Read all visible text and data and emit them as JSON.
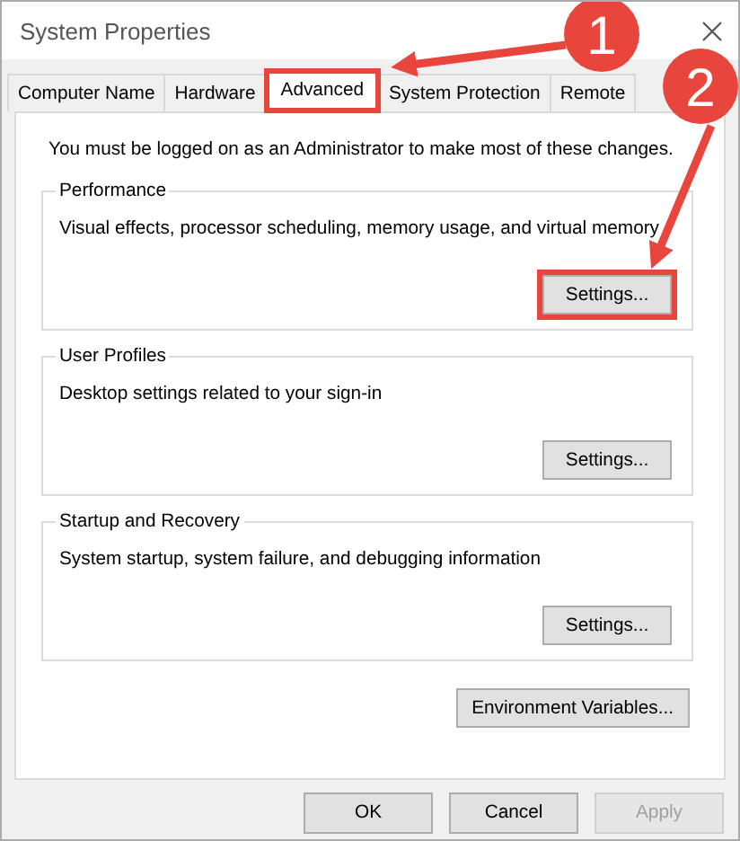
{
  "window": {
    "title": "System Properties"
  },
  "tabs": [
    {
      "label": "Computer Name",
      "selected": false,
      "highlighted": false
    },
    {
      "label": "Hardware",
      "selected": false,
      "highlighted": false
    },
    {
      "label": "Advanced",
      "selected": true,
      "highlighted": true
    },
    {
      "label": "System Protection",
      "selected": false,
      "highlighted": false
    },
    {
      "label": "Remote",
      "selected": false,
      "highlighted": false
    }
  ],
  "notice": "You must be logged on as an Administrator to make most of these changes.",
  "groups": [
    {
      "title": "Performance",
      "description": "Visual effects, processor scheduling, memory usage, and virtual memory",
      "button": {
        "label": "Settings...",
        "highlighted": true
      }
    },
    {
      "title": "User Profiles",
      "description": "Desktop settings related to your sign-in",
      "button": {
        "label": "Settings...",
        "highlighted": false
      }
    },
    {
      "title": "Startup and Recovery",
      "description": "System startup, system failure, and debugging information",
      "button": {
        "label": "Settings...",
        "highlighted": false
      }
    }
  ],
  "environment_button": {
    "label": "Environment Variables..."
  },
  "buttons": [
    {
      "label": "OK",
      "disabled": false
    },
    {
      "label": "Cancel",
      "disabled": false
    },
    {
      "label": "Apply",
      "disabled": true
    }
  ],
  "annotations": [
    {
      "kind": "step-marker",
      "number": "1"
    },
    {
      "kind": "step-marker",
      "number": "2"
    }
  ]
}
